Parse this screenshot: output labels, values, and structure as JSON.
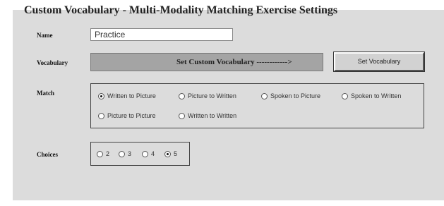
{
  "window": {
    "title": "Custom Vocabulary - Multi-Modality Matching Exercise Settings"
  },
  "name": {
    "label": "Name",
    "value": "Practice"
  },
  "vocabulary": {
    "label": "Vocabulary",
    "bar_text": "Set Custom Vocabulary ------------>",
    "button_label": "Set Vocabulary"
  },
  "match": {
    "label": "Match",
    "options": [
      {
        "label": "Written to Picture",
        "checked": true
      },
      {
        "label": "Picture to Written",
        "checked": false
      },
      {
        "label": "Spoken to Picture",
        "checked": false
      },
      {
        "label": "Spoken to Written",
        "checked": false
      },
      {
        "label": "Picture to Picture",
        "checked": false
      },
      {
        "label": "Written to Written",
        "checked": false
      }
    ]
  },
  "choices": {
    "label": "Choices",
    "options": [
      {
        "label": "2",
        "checked": false
      },
      {
        "label": "3",
        "checked": false
      },
      {
        "label": "4",
        "checked": false
      },
      {
        "label": "5",
        "checked": true
      }
    ]
  }
}
